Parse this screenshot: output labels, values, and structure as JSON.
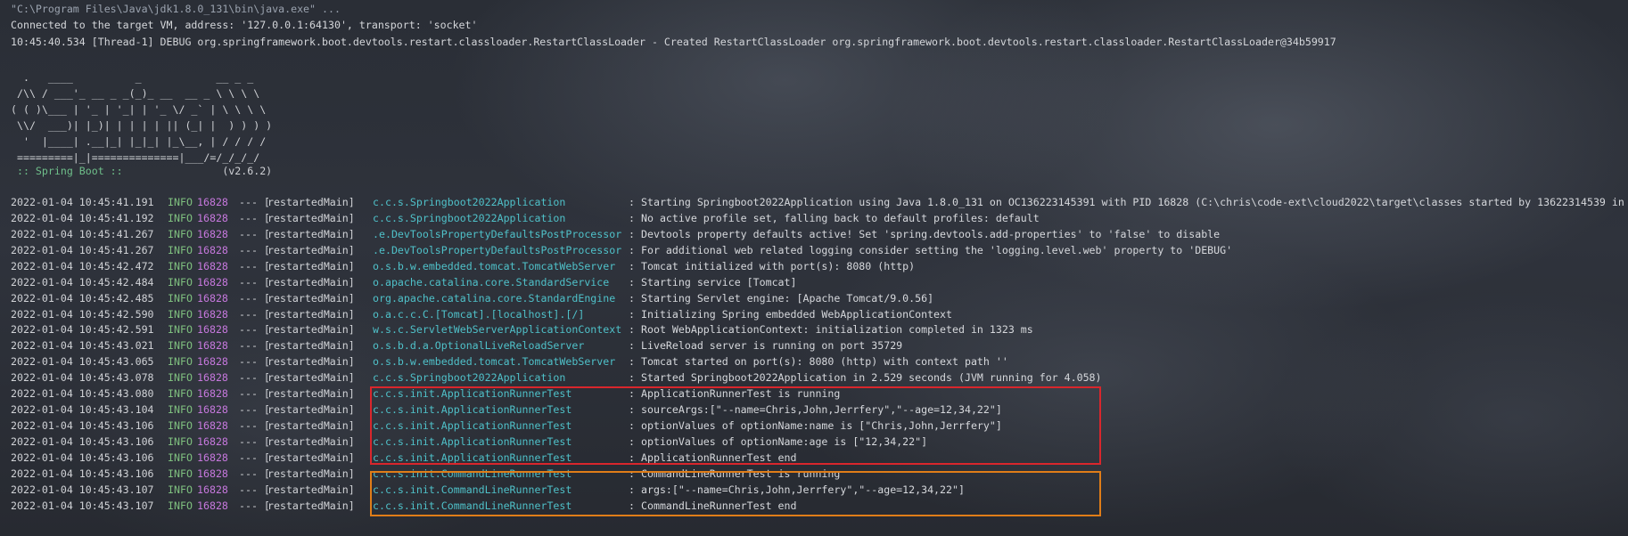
{
  "console": {
    "header_lines": [
      "\"C:\\Program Files\\Java\\jdk1.8.0_131\\bin\\java.exe\" ...",
      "Connected to the target VM, address: '127.0.0.1:64130', transport: 'socket'",
      "10:45:40.534 [Thread-1] DEBUG org.springframework.boot.devtools.restart.classloader.RestartClassLoader - Created RestartClassLoader org.springframework.boot.devtools.restart.classloader.RestartClassLoader@34b59917"
    ],
    "banner": [
      "  .   ____          _            __ _ _",
      " /\\\\ / ___'_ __ _ _(_)_ __  __ _ \\ \\ \\ \\",
      "( ( )\\___ | '_ | '_| | '_ \\/ _` | \\ \\ \\ \\",
      " \\\\/  ___)| |_)| | | | | || (_| |  ) ) ) )",
      "  '  |____| .__|_| |_|_| |_\\__, | / / / /",
      " =========|_|==============|___/=/_/_/_/"
    ],
    "boot_label": " :: Spring Boot :: ",
    "boot_version": "               (v2.6.2)",
    "log_entries": [
      {
        "ts": "2022-01-04 10:45:41.191",
        "level": "INFO",
        "pid": "16828",
        "sep": "--- [",
        "thread": "restartedMain]",
        "logger": "c.c.s.Springboot2022Application",
        "msg": "Starting Springboot2022Application using Java 1.8.0_131 on OC136223145391 with PID 16828 (C:\\chris\\code-ext\\cloud2022\\target\\classes started by 13622314539 in"
      },
      {
        "ts": "2022-01-04 10:45:41.192",
        "level": "INFO",
        "pid": "16828",
        "sep": "--- [",
        "thread": "restartedMain]",
        "logger": "c.c.s.Springboot2022Application",
        "msg": "No active profile set, falling back to default profiles: default"
      },
      {
        "ts": "2022-01-04 10:45:41.267",
        "level": "INFO",
        "pid": "16828",
        "sep": "--- [",
        "thread": "restartedMain]",
        "logger": ".e.DevToolsPropertyDefaultsPostProcessor",
        "msg": "Devtools property defaults active! Set 'spring.devtools.add-properties' to 'false' to disable"
      },
      {
        "ts": "2022-01-04 10:45:41.267",
        "level": "INFO",
        "pid": "16828",
        "sep": "--- [",
        "thread": "restartedMain]",
        "logger": ".e.DevToolsPropertyDefaultsPostProcessor",
        "msg": "For additional web related logging consider setting the 'logging.level.web' property to 'DEBUG'"
      },
      {
        "ts": "2022-01-04 10:45:42.472",
        "level": "INFO",
        "pid": "16828",
        "sep": "--- [",
        "thread": "restartedMain]",
        "logger": "o.s.b.w.embedded.tomcat.TomcatWebServer",
        "msg": "Tomcat initialized with port(s): 8080 (http)"
      },
      {
        "ts": "2022-01-04 10:45:42.484",
        "level": "INFO",
        "pid": "16828",
        "sep": "--- [",
        "thread": "restartedMain]",
        "logger": "o.apache.catalina.core.StandardService",
        "msg": "Starting service [Tomcat]"
      },
      {
        "ts": "2022-01-04 10:45:42.485",
        "level": "INFO",
        "pid": "16828",
        "sep": "--- [",
        "thread": "restartedMain]",
        "logger": "org.apache.catalina.core.StandardEngine",
        "msg": "Starting Servlet engine: [Apache Tomcat/9.0.56]"
      },
      {
        "ts": "2022-01-04 10:45:42.590",
        "level": "INFO",
        "pid": "16828",
        "sep": "--- [",
        "thread": "restartedMain]",
        "logger": "o.a.c.c.C.[Tomcat].[localhost].[/]",
        "msg": "Initializing Spring embedded WebApplicationContext"
      },
      {
        "ts": "2022-01-04 10:45:42.591",
        "level": "INFO",
        "pid": "16828",
        "sep": "--- [",
        "thread": "restartedMain]",
        "logger": "w.s.c.ServletWebServerApplicationContext",
        "msg": "Root WebApplicationContext: initialization completed in 1323 ms"
      },
      {
        "ts": "2022-01-04 10:45:43.021",
        "level": "INFO",
        "pid": "16828",
        "sep": "--- [",
        "thread": "restartedMain]",
        "logger": "o.s.b.d.a.OptionalLiveReloadServer",
        "msg": "LiveReload server is running on port 35729"
      },
      {
        "ts": "2022-01-04 10:45:43.065",
        "level": "INFO",
        "pid": "16828",
        "sep": "--- [",
        "thread": "restartedMain]",
        "logger": "o.s.b.w.embedded.tomcat.TomcatWebServer",
        "msg": "Tomcat started on port(s): 8080 (http) with context path ''"
      },
      {
        "ts": "2022-01-04 10:45:43.078",
        "level": "INFO",
        "pid": "16828",
        "sep": "--- [",
        "thread": "restartedMain]",
        "logger": "c.c.s.Springboot2022Application",
        "msg": "Started Springboot2022Application in 2.529 seconds (JVM running for 4.058)"
      },
      {
        "ts": "2022-01-04 10:45:43.080",
        "level": "INFO",
        "pid": "16828",
        "sep": "--- [",
        "thread": "restartedMain]",
        "logger": "c.c.s.init.ApplicationRunnerTest",
        "msg": "ApplicationRunnerTest is running"
      },
      {
        "ts": "2022-01-04 10:45:43.104",
        "level": "INFO",
        "pid": "16828",
        "sep": "--- [",
        "thread": "restartedMain]",
        "logger": "c.c.s.init.ApplicationRunnerTest",
        "msg": "sourceArgs:[\"--name=Chris,John,Jerrfery\",\"--age=12,34,22\"]"
      },
      {
        "ts": "2022-01-04 10:45:43.106",
        "level": "INFO",
        "pid": "16828",
        "sep": "--- [",
        "thread": "restartedMain]",
        "logger": "c.c.s.init.ApplicationRunnerTest",
        "msg": "optionValues of optionName:name is [\"Chris,John,Jerrfery\"]"
      },
      {
        "ts": "2022-01-04 10:45:43.106",
        "level": "INFO",
        "pid": "16828",
        "sep": "--- [",
        "thread": "restartedMain]",
        "logger": "c.c.s.init.ApplicationRunnerTest",
        "msg": "optionValues of optionName:age is [\"12,34,22\"]"
      },
      {
        "ts": "2022-01-04 10:45:43.106",
        "level": "INFO",
        "pid": "16828",
        "sep": "--- [",
        "thread": "restartedMain]",
        "logger": "c.c.s.init.ApplicationRunnerTest",
        "msg": "ApplicationRunnerTest end"
      },
      {
        "ts": "2022-01-04 10:45:43.106",
        "level": "INFO",
        "pid": "16828",
        "sep": "--- [",
        "thread": "restartedMain]",
        "logger": "c.c.s.init.CommandLineRunnerTest",
        "msg": "CommandLineRunnerTest is running"
      },
      {
        "ts": "2022-01-04 10:45:43.107",
        "level": "INFO",
        "pid": "16828",
        "sep": "--- [",
        "thread": "restartedMain]",
        "logger": "c.c.s.init.CommandLineRunnerTest",
        "msg": "args:[\"--name=Chris,John,Jerrfery\",\"--age=12,34,22\"]"
      },
      {
        "ts": "2022-01-04 10:45:43.107",
        "level": "INFO",
        "pid": "16828",
        "sep": "--- [",
        "thread": "restartedMain]",
        "logger": "c.c.s.init.CommandLineRunnerTest",
        "msg": "CommandLineRunnerTest end"
      }
    ]
  },
  "highlights": {
    "application_runner_color": "#d9262c",
    "command_line_runner_color": "#e07d18"
  }
}
